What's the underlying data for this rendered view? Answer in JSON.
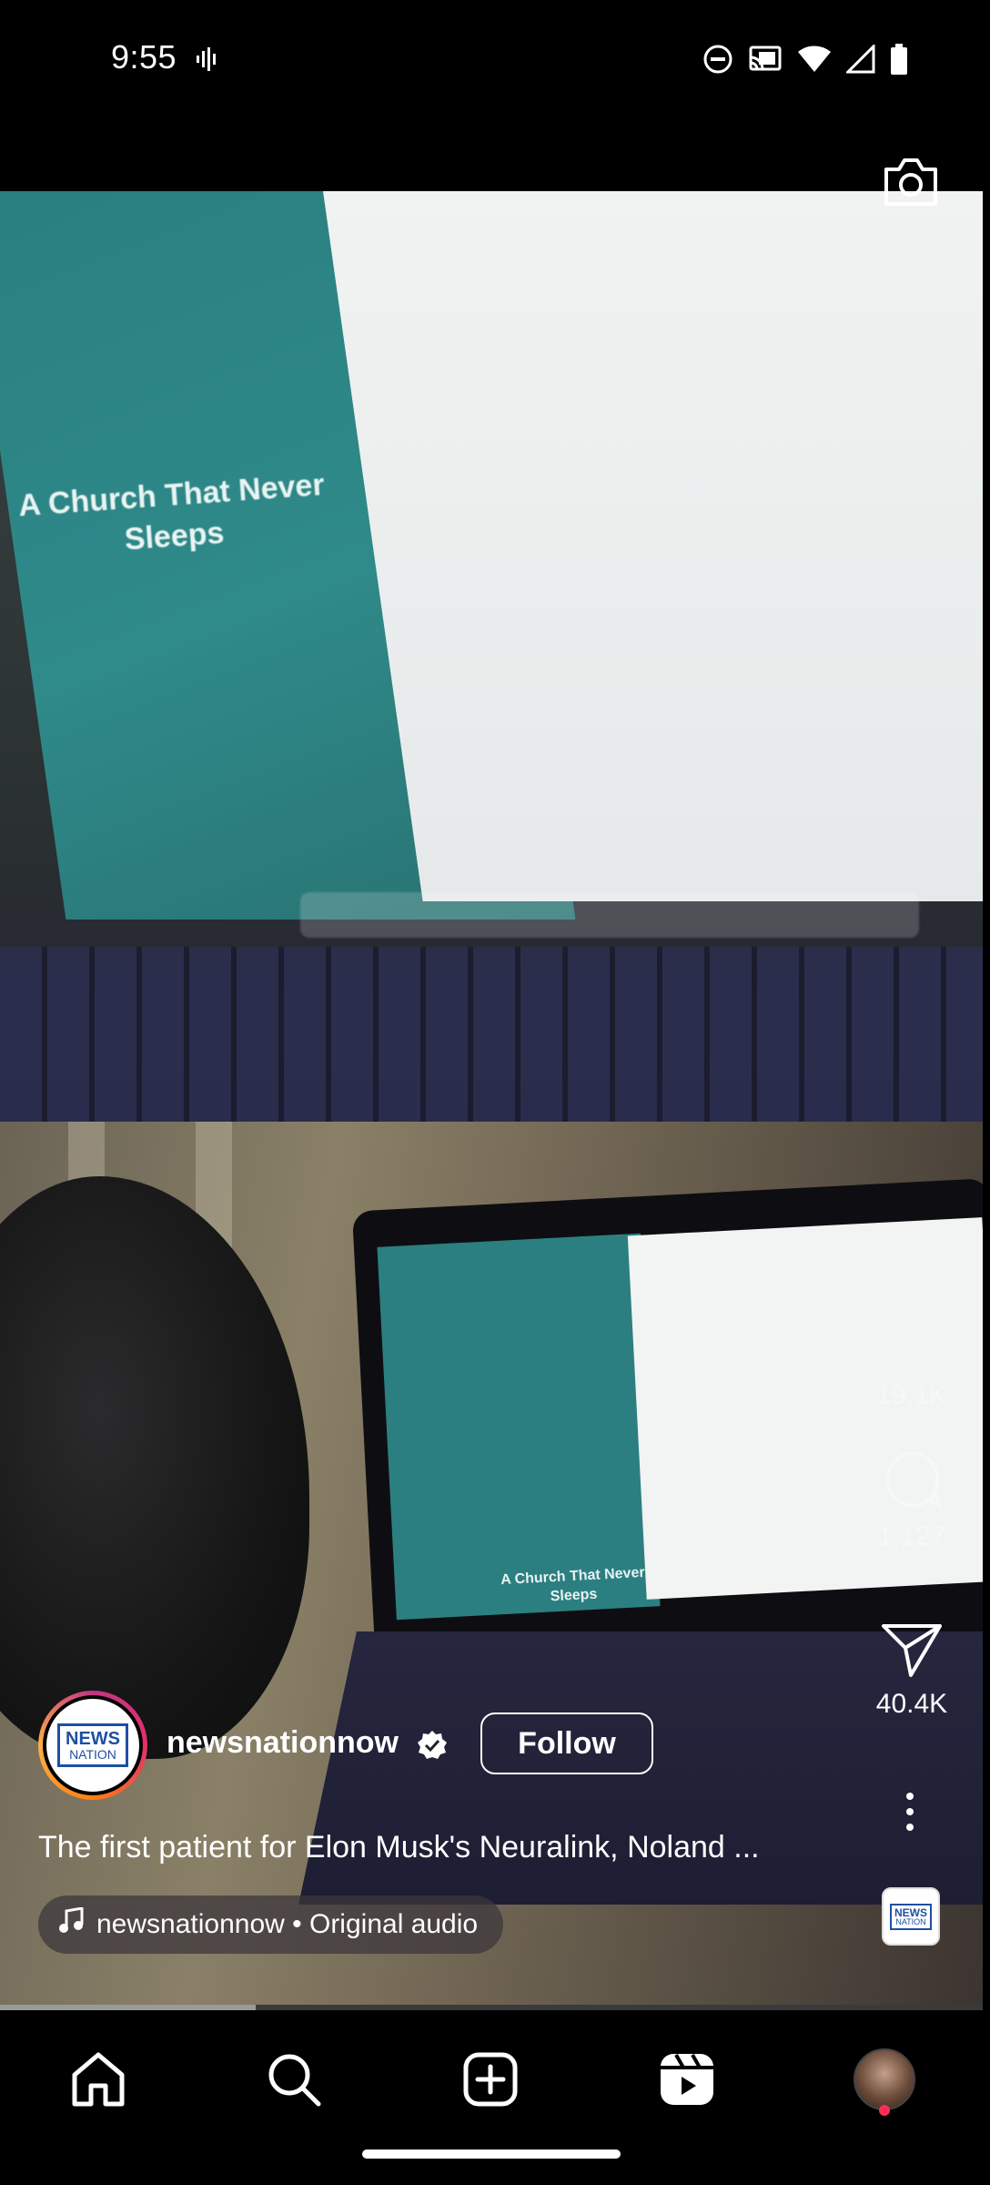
{
  "status_bar": {
    "time": "9:55",
    "left_icons": [
      "voice-activity-icon"
    ],
    "right_icons": [
      "do-not-disturb-icon",
      "cast-icon",
      "wifi-icon",
      "signal-icon",
      "battery-icon"
    ]
  },
  "video": {
    "screen_title": "A Church That Never Sleeps",
    "laptop_title": "A Church That Never Sleeps"
  },
  "actions": {
    "likes": "19.1K",
    "comments": "1,127",
    "shares": "40.4K"
  },
  "author": {
    "username": "newsnationnow",
    "logo_line1": "NEWS",
    "logo_line2": "NATION",
    "follow_label": "Follow"
  },
  "caption": "The first patient for Elon Musk's Neuralink, Noland ...",
  "audio": {
    "label": "newsnationnow • Original audio"
  },
  "progress": 0.26,
  "nav": [
    "home-icon",
    "search-icon",
    "create-post-icon",
    "reels-icon",
    "profile-avatar"
  ],
  "colors": {
    "background": "#000000",
    "accent_red": "#ff2d55",
    "story_ring": "#e1306c",
    "brand_blue": "#1f4fa3"
  }
}
